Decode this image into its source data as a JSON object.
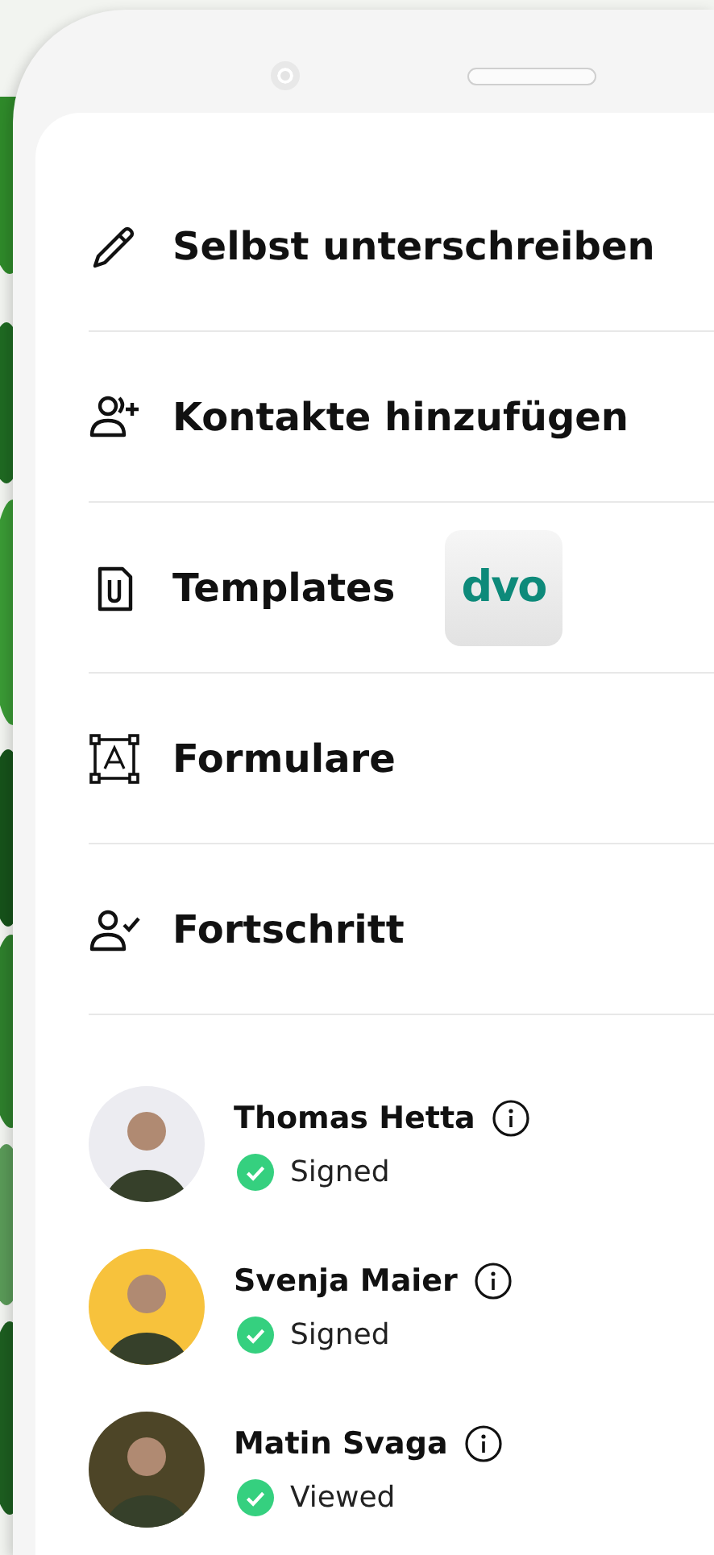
{
  "menu": [
    {
      "kind": "pencil",
      "label": "Selbst unterschreiben"
    },
    {
      "kind": "add-contact",
      "label": "Kontakte hinzufügen"
    },
    {
      "kind": "attachment",
      "label": "Templates",
      "badge": "dvo"
    },
    {
      "kind": "form",
      "label": "Formulare"
    },
    {
      "kind": "progress",
      "label": "Fortschritt"
    }
  ],
  "signers": [
    {
      "name": "Thomas Hetta",
      "status": "Signed",
      "color": "#ececf1"
    },
    {
      "name": "Svenja Maier",
      "status": "Signed",
      "color": "#f7c23c"
    },
    {
      "name": "Matin Svaga",
      "status": "Viewed",
      "color": "#4d4527"
    }
  ]
}
